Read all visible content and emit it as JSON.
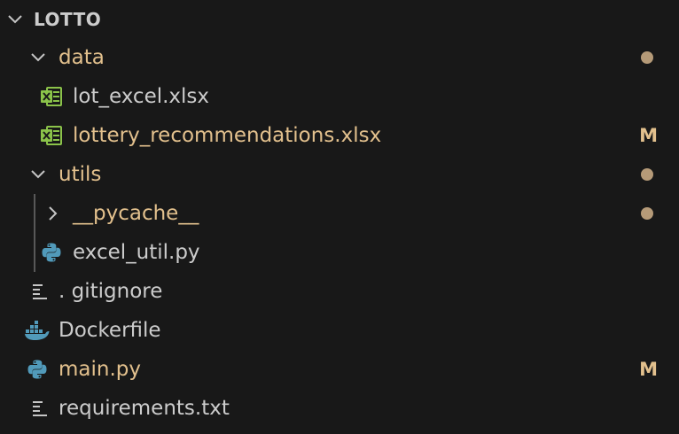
{
  "colors": {
    "background": "#181818",
    "default_text": "#cccccc",
    "modified_text": "#e2c08d",
    "dot": "#b59a78",
    "indent_guide": "#585858",
    "twisty": "#c5c5c5",
    "excel_icon": "#8bc34a",
    "python_icon": "#519aba",
    "docker_icon": "#519aba",
    "text_icon": "#c5c5c5"
  },
  "root": {
    "label": "LOTTO",
    "expanded": true
  },
  "items": [
    {
      "label": "data",
      "type": "folder",
      "expanded": true,
      "modified": true,
      "icon": "chevron-down-icon",
      "decoration": "dot"
    },
    {
      "label": "lot_excel.xlsx",
      "type": "file",
      "modified": false,
      "icon": "excel-icon",
      "decoration": ""
    },
    {
      "label": "lottery_recommendations.xlsx",
      "type": "file",
      "modified": true,
      "icon": "excel-icon",
      "decoration": "M"
    },
    {
      "label": "utils",
      "type": "folder",
      "expanded": true,
      "modified": true,
      "icon": "chevron-down-icon",
      "decoration": "dot"
    },
    {
      "label": "__pycache__",
      "type": "folder",
      "expanded": false,
      "modified": true,
      "icon": "chevron-right-icon",
      "decoration": "dot"
    },
    {
      "label": "excel_util.py",
      "type": "file",
      "modified": false,
      "icon": "python-icon",
      "decoration": ""
    },
    {
      "label": ". gitignore",
      "type": "file",
      "modified": false,
      "icon": "lines-icon",
      "decoration": ""
    },
    {
      "label": "Dockerfile",
      "type": "file",
      "modified": false,
      "icon": "docker-icon",
      "decoration": ""
    },
    {
      "label": "main.py",
      "type": "file",
      "modified": true,
      "icon": "python-icon",
      "decoration": "M"
    },
    {
      "label": "requirements.txt",
      "type": "file",
      "modified": false,
      "icon": "lines-icon",
      "decoration": ""
    }
  ]
}
